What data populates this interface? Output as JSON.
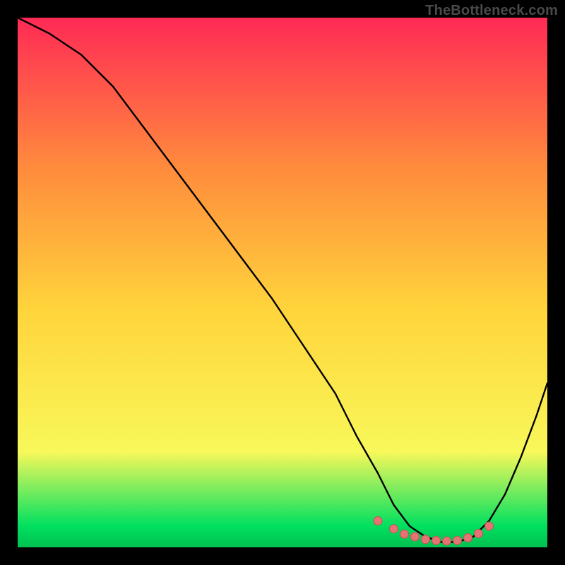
{
  "watermark": "TheBottleneck.com",
  "colors": {
    "curve": "#000000",
    "marker_fill": "#e57373",
    "marker_stroke": "#c05555",
    "gradient_top": "#ff2a55",
    "gradient_upper_mid": "#ff8a3d",
    "gradient_mid": "#ffd43b",
    "gradient_lower_mid": "#f8f85a",
    "gradient_green": "#00e060",
    "gradient_bottom": "#00c050"
  },
  "chart_data": {
    "type": "line",
    "title": "",
    "xlabel": "",
    "ylabel": "",
    "xlim": [
      0,
      100
    ],
    "ylim": [
      0,
      100
    ],
    "series": [
      {
        "name": "bottleneck-curve",
        "x": [
          0,
          6,
          12,
          18,
          24,
          30,
          36,
          42,
          48,
          54,
          60,
          64,
          68,
          71,
          74,
          77,
          80,
          83,
          86,
          89,
          92,
          95,
          98,
          100
        ],
        "y": [
          100,
          97,
          93,
          87,
          79,
          71,
          63,
          55,
          47,
          38,
          29,
          21,
          14,
          8,
          4,
          2,
          1,
          1,
          2,
          5,
          10,
          17,
          25,
          31
        ]
      }
    ],
    "markers": {
      "name": "optimal-range",
      "x": [
        68,
        71,
        73,
        75,
        77,
        79,
        81,
        83,
        85,
        87,
        89
      ],
      "y": [
        5,
        3.5,
        2.5,
        2,
        1.5,
        1.3,
        1.2,
        1.3,
        1.8,
        2.6,
        4
      ]
    }
  }
}
